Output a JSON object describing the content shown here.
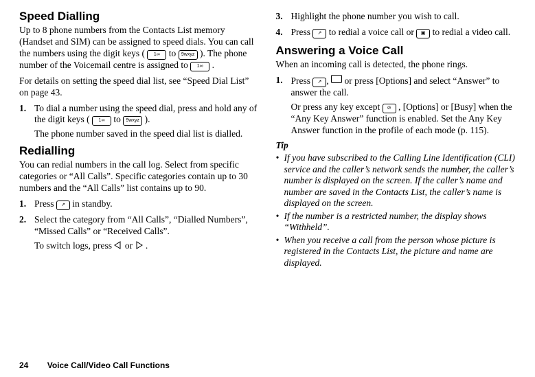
{
  "left": {
    "speed": {
      "heading": "Speed Dialling",
      "p1_a": "Up to 8 phone numbers from the Contacts List memory (Handset and SIM) can be assigned to speed dials. You can call the numbers using the digit keys (",
      "p1_b": " to ",
      "p1_c": "). The phone number of the Voicemail centre is assigned to ",
      "p1_d": ".",
      "p2": "For details on setting the speed dial list, see “Speed Dial List” on page 43.",
      "step1_a": "To dial a number using the speed dial, press and hold any of the digit keys (",
      "step1_b": " to ",
      "step1_c": ").",
      "step1_sub": "The phone number saved in the speed dial list is dialled."
    },
    "redial": {
      "heading": "Redialling",
      "p1": "You can redial numbers in the call log. Select from specific categories or “All Calls”. Specific categories contain up to 30 numbers and the “All Calls” list contains up to 90.",
      "step1_a": "Press ",
      "step1_b": " in standby.",
      "step2": "Select the category from “All Calls”, “Dialled Numbers”, “Missed Calls” or “Received Calls”.",
      "step2_sub_a": "To switch logs, press ",
      "step2_sub_b": " or ",
      "step2_sub_c": "."
    }
  },
  "right": {
    "redial_cont": {
      "step3": "Highlight the phone number you wish to call.",
      "step4_a": "Press ",
      "step4_b": " to redial a voice call or ",
      "step4_c": " to redial a video call."
    },
    "answer": {
      "heading": "Answering a Voice Call",
      "p1": "When an incoming call is detected, the phone rings.",
      "step1_a": "Press ",
      "step1_b": ", ",
      "step1_c": " or press [Options] and select “Answer” to answer the call.",
      "step1_sub_a": "Or press any key except ",
      "step1_sub_b": ", [Options] or [Busy] when the “Any Key Answer” function is enabled. Set the Any Key Answer function in the profile of each mode (p. 115)."
    },
    "tip_heading": "Tip",
    "tips": [
      "If you have subscribed to the Calling Line Identification (CLI) service and the caller’s network sends the number, the caller’s number is displayed on the screen. If the caller’s name and number are saved in the Contacts List, the caller’s name is displayed on the screen.",
      "If the number is a restricted number, the display shows “Withheld”.",
      "When you receive a call from the person whose picture is registered in the Contacts List, the picture and name are displayed."
    ]
  },
  "keys": {
    "k1": "1∞",
    "k9": "9wxyz",
    "send": "↗",
    "end": "⊘",
    "video": "▣"
  },
  "footer": {
    "page": "24",
    "title": "Voice Call/Video Call Functions"
  }
}
